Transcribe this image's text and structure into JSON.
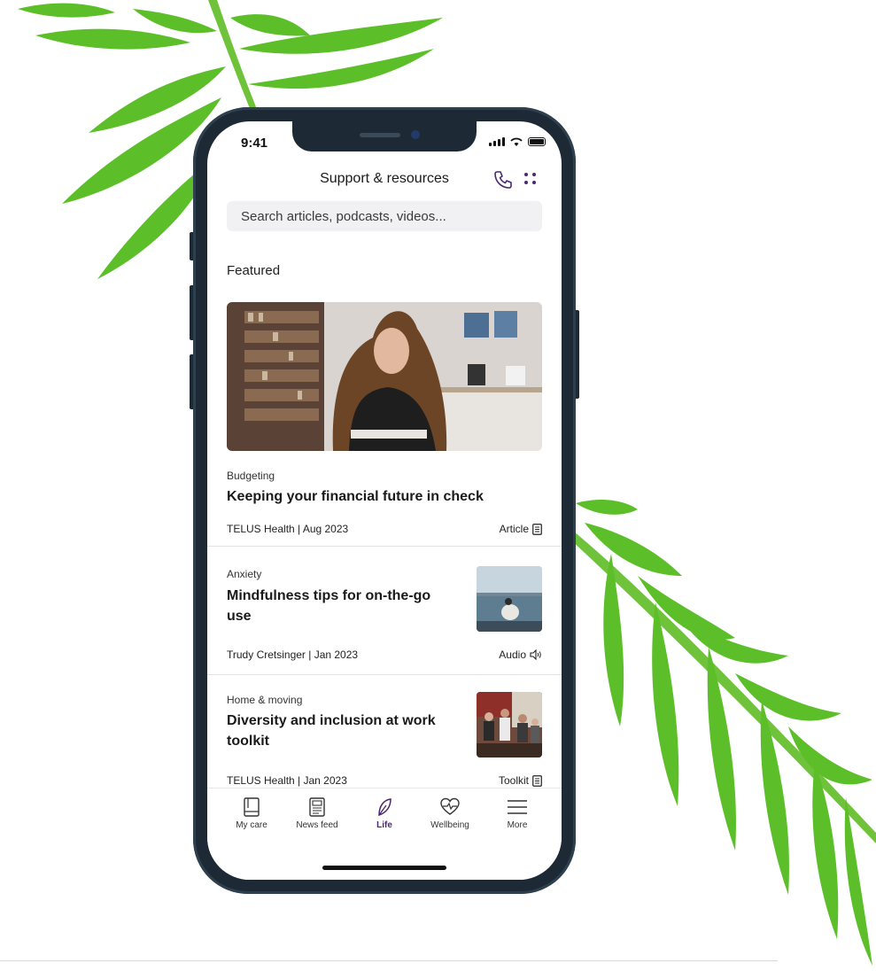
{
  "status": {
    "time": "9:41"
  },
  "header": {
    "title": "Support & resources",
    "call_icon": "phone-icon",
    "menu_icon": "grid-dots-icon"
  },
  "search": {
    "placeholder": "Search articles, podcasts, videos..."
  },
  "featured": {
    "section_label": "Featured",
    "category": "Budgeting",
    "title": "Keeping your financial future in check",
    "byline": "TELUS Health | Aug 2023",
    "type": "Article"
  },
  "cards": [
    {
      "category": "Anxiety",
      "title": "Mindfulness tips for on-the-go use",
      "byline": "Trudy Cretsinger | Jan 2023",
      "type": "Audio"
    },
    {
      "category": "Home & moving",
      "title": "Diversity and inclusion at work toolkit",
      "byline": "TELUS Health | Jan 2023",
      "type": "Toolkit"
    }
  ],
  "tabs": [
    {
      "label": "My care",
      "icon": "book-icon"
    },
    {
      "label": "News feed",
      "icon": "newspaper-icon"
    },
    {
      "label": "Life",
      "icon": "leaf-icon",
      "active": true
    },
    {
      "label": "Wellbeing",
      "icon": "heart-pulse-icon"
    },
    {
      "label": "More",
      "icon": "hamburger-icon"
    }
  ],
  "colors": {
    "accent": "#4b286d",
    "phone_frame": "#1d2a36",
    "leaf": "#5cbf2a"
  }
}
